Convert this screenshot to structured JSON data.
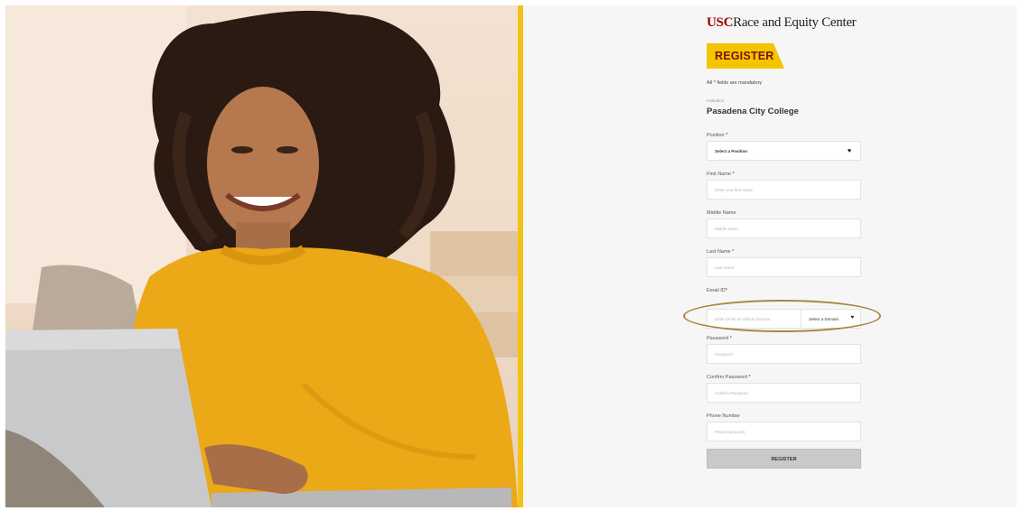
{
  "brand": {
    "usc": "USC",
    "name": "Race and Equity Center"
  },
  "form": {
    "banner": "REGISTER",
    "mandatory_prefix": "All",
    "mandatory_star": "*",
    "mandatory_suffix": "fields are mandatory",
    "institution_caption": "Institution",
    "institution_name": "Pasadena City College",
    "position": {
      "label": "Position",
      "value": "Select a Position",
      "icon": "chevron-down-icon"
    },
    "first_name": {
      "label": "First Name",
      "placeholder": "Enter your first name"
    },
    "middle_name": {
      "label": "Middle Name",
      "placeholder": "Middle name"
    },
    "last_name": {
      "label": "Last Name",
      "placeholder": "Last name"
    },
    "email": {
      "label": "Email ID",
      "placeholder": "Enter Email ID without Domain",
      "domain_value": "Select a Domain",
      "icon": "chevron-down-icon"
    },
    "password": {
      "label": "Password",
      "placeholder": "Password"
    },
    "confirm_password": {
      "label": "Confirm Password",
      "placeholder": "Confirm Password"
    },
    "phone": {
      "label": "Phone Number",
      "placeholder": "Phone (optional)"
    },
    "submit_label": "REGISTER",
    "required_marker": "*"
  },
  "colors": {
    "accent_yellow": "#f5c400",
    "usc_cardinal": "#990000",
    "highlight_ring": "#a8863d",
    "panel_bg": "#f6f6f6"
  }
}
